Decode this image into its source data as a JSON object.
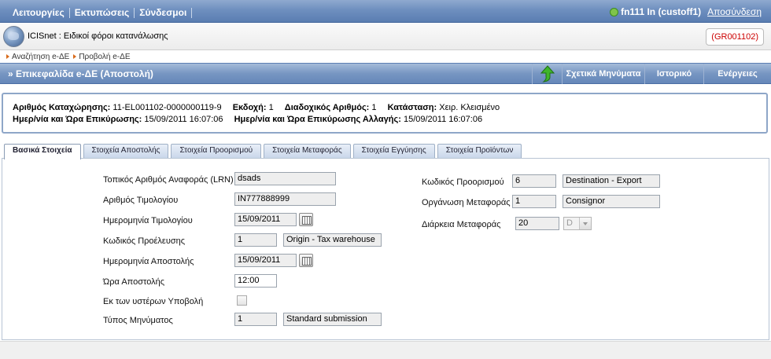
{
  "menu": {
    "items": [
      "Λειτουργίες",
      "Εκτυπώσεις",
      "Σύνδεσμοι"
    ]
  },
  "user": {
    "name": "fn111 In (custoff1)",
    "logout": "Αποσύνδεση"
  },
  "app": {
    "title": "ICISnet : Ειδικοί φόροι κατανάλωσης",
    "ref": "(GR001102)"
  },
  "breadcrumb": [
    "Αναζήτηση e-ΔΕ",
    "Προβολή e-ΔΕ"
  ],
  "section": {
    "title": "» Επικεφαλίδα e-ΔΕ (Αποστολή)",
    "buttons": [
      "Σχετικά Μηνύματα",
      "Ιστορικό",
      "Ενέργειες"
    ]
  },
  "info": {
    "reg_label": "Αριθμός Καταχώρησης:",
    "reg_value": "11-EL001102-0000000119-9",
    "version_label": "Εκδοχή:",
    "version_value": "1",
    "seq_label": "Διαδοχικός Αριθμός:",
    "seq_value": "1",
    "status_label": "Κατάσταση:",
    "status_value": "Χειρ. Κλεισμένο",
    "valdt_label": "Ημερ/νία και Ώρα Επικύρωσης:",
    "valdt_value": "15/09/2011 16:07:06",
    "chgdt_label": "Ημερ/νία και Ώρα Επικύρωσης Αλλαγής:",
    "chgdt_value": "15/09/2011 16:07:06"
  },
  "tabs": [
    "Βασικά Στοιχεία",
    "Στοιχεία Αποστολής",
    "Στοιχεία Προορισμού",
    "Στοιχεία Μεταφοράς",
    "Στοιχεία Εγγύησης",
    "Στοιχεία Προϊόντων"
  ],
  "form_left": {
    "lrn_label": "Τοπικός Αριθμός Αναφοράς (LRN)",
    "lrn_value": "dsads",
    "inv_label": "Αριθμός Τιμολογίου",
    "inv_value": "IN777888999",
    "invdate_label": "Ημερομηνία Τιμολογίου",
    "invdate_value": "15/09/2011",
    "origin_label": "Κωδικός Προέλευσης",
    "origin_code": "1",
    "origin_desc": "Origin - Tax warehouse",
    "dispdate_label": "Ημερομηνία Αποστολής",
    "dispdate_value": "15/09/2011",
    "disptime_label": "Ώρα Αποστολής",
    "disptime_value": "12:00",
    "deferred_label": "Εκ των υστέρων Υποβολή",
    "msgtype_label": "Τύπος Μηνύματος",
    "msgtype_code": "1",
    "msgtype_desc": "Standard submission"
  },
  "form_right": {
    "dest_label": "Κωδικός Προορισμού",
    "dest_code": "6",
    "dest_desc": "Destination - Export",
    "transorg_label": "Οργάνωση Μεταφοράς",
    "transorg_code": "1",
    "transorg_desc": "Consignor",
    "duration_label": "Διάρκεια Μεταφοράς",
    "duration_value": "20",
    "duration_unit": "D"
  },
  "colors": {
    "header_blue": "#6e8fbf",
    "ref_red": "#cc0000",
    "crumb_arrow": "#d86a1a"
  },
  "icons": [
    "user-status-icon",
    "globe-icon",
    "go-arrow-icon",
    "calendar-icon",
    "chevron-down-icon"
  ]
}
